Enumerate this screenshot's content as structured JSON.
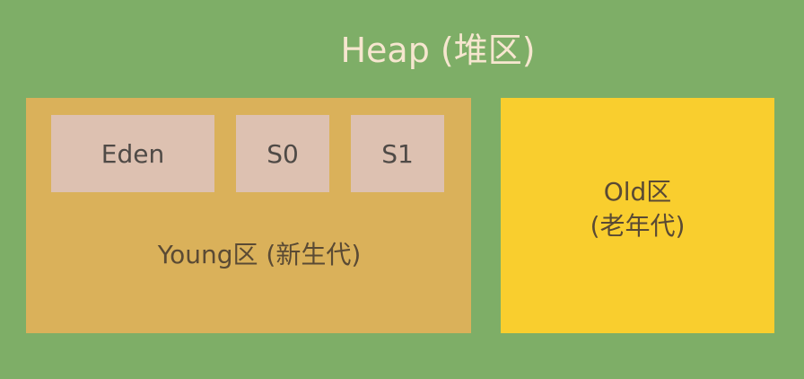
{
  "heap": {
    "title": "Heap (堆区)"
  },
  "young": {
    "label": "Young区 (新生代)",
    "blocks": [
      "Eden",
      "S0",
      "S1"
    ]
  },
  "old": {
    "line1": "Old区",
    "line2": "(老年代)"
  },
  "colors": {
    "background": "#7eae67",
    "young": "#dab15a",
    "survivor_blocks": "#ddc1b1",
    "old": "#f9ce2e",
    "title_text": "#f6e6cf"
  }
}
